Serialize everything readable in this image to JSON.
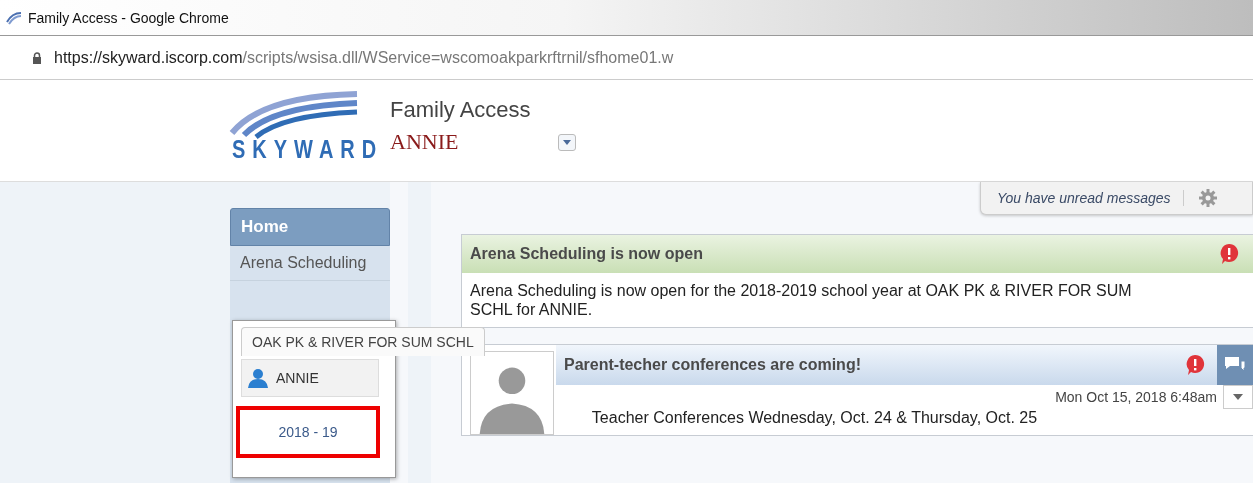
{
  "window": {
    "title": "Family Access - Google Chrome"
  },
  "address_bar": {
    "host": "https://skyward.iscorp.com",
    "path": "/scripts/wsisa.dll/WService=wscomoakparkrftrnil/sfhome01.w"
  },
  "header": {
    "logo_text": "SKYWARD",
    "app_title": "Family Access",
    "student_name": "ANNIE"
  },
  "unread_notice": "You have unread messages",
  "nav": [
    {
      "label": "Home",
      "selected": true
    },
    {
      "label": "Arena Scheduling",
      "selected": false
    }
  ],
  "student_popup": {
    "school": "OAK PK & RIVER FOR SUM SCHL",
    "student": "ANNIE",
    "year": "2018 - 19",
    "year_highlighted": true
  },
  "messages": [
    {
      "kind": "announcement",
      "title": "Arena Scheduling is now open",
      "body": "Arena Scheduling is now open for the 2018-2019 school year at OAK PK & RIVER FOR SUM SCHL for ANNIE."
    },
    {
      "kind": "teacher",
      "title": "Parent-techer conferences are coming!",
      "date": "Mon Oct 15, 2018 6:48am",
      "body": "Teacher Conferences Wednesday, Oct. 24 & Thursday, Oct. 25"
    }
  ]
}
